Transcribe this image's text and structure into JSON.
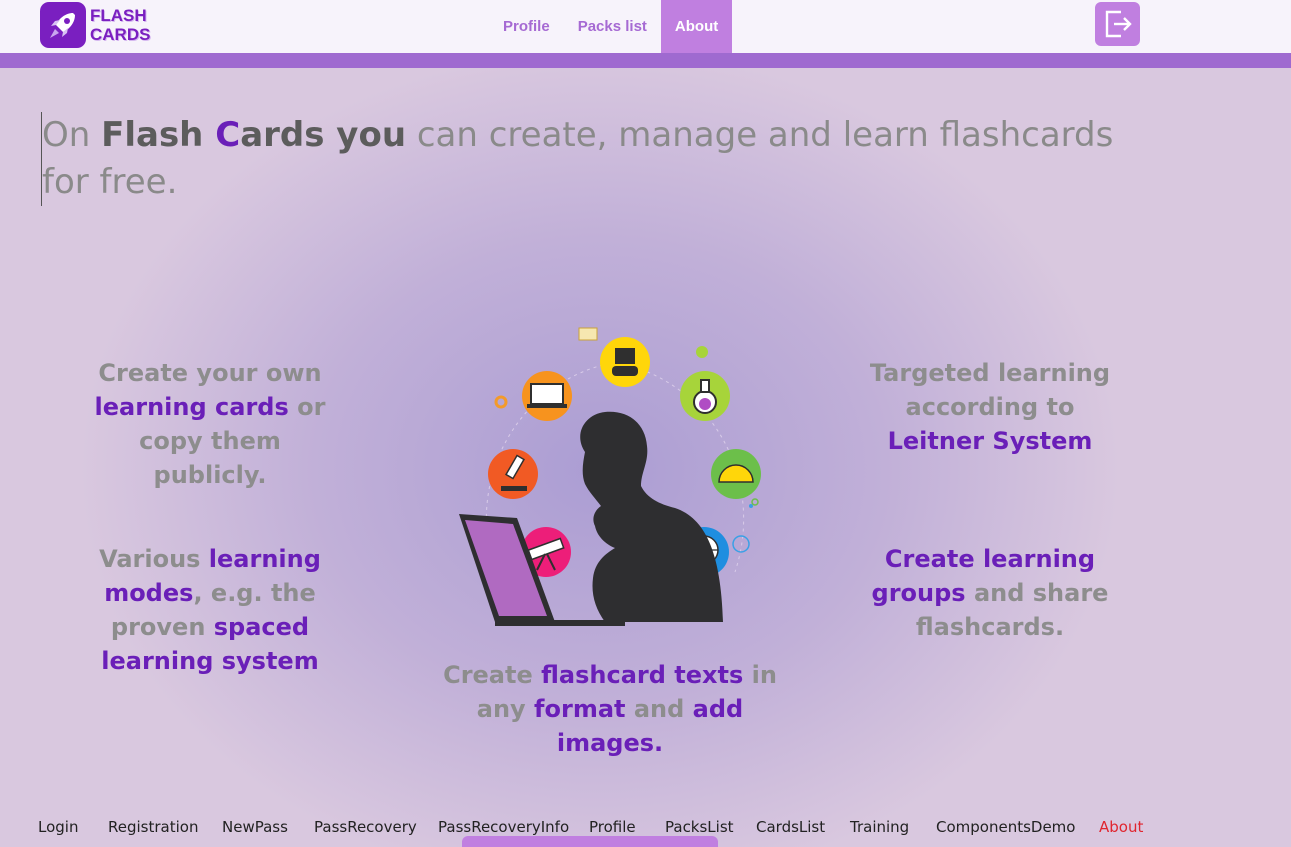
{
  "brand": {
    "line1": "FLASH",
    "line2": "CARDS",
    "icon": "rocket-icon"
  },
  "nav": {
    "items": [
      {
        "label": "Profile"
      },
      {
        "label": "Packs list"
      },
      {
        "label": "About"
      }
    ],
    "active": "About",
    "logout_icon": "logout-icon"
  },
  "intro": {
    "prefix": "On ",
    "brand_flash": "Flash ",
    "brand_c": "C",
    "brand_rest": "ards you",
    "suffix": " can create, manage and learn flashcards for free."
  },
  "features": {
    "create_cards": {
      "t1": "Create your own ",
      "h1": "learning cards",
      "t2": " or copy them publicly."
    },
    "modes": {
      "t1": "Various ",
      "h1": "learning modes",
      "t2": ", e.g. the proven ",
      "h2": "spaced learning system"
    },
    "texts": {
      "t1": "Create ",
      "h1": "flashcard texts",
      "t2": " in any ",
      "h2": "format",
      "t3": " and ",
      "h3": "add images."
    },
    "leitner": {
      "t1": "Targeted learning according to ",
      "h1": "Leitner System"
    },
    "groups": {
      "h1": "Create learning groups",
      "t1": " and share flashcards."
    }
  },
  "footer": {
    "links": [
      "Login",
      "Registration",
      "NewPass",
      "PassRecovery",
      "PassRecoveryInfo",
      "Profile",
      "PacksList",
      "CardsList",
      "Training",
      "ComponentsDemo",
      "About"
    ],
    "current": "About"
  },
  "colors": {
    "accent": "#6a1fb8",
    "nav_active": "#c07fe0",
    "header_bar": "#9f6ad0",
    "footer_current": "#e0252f"
  }
}
